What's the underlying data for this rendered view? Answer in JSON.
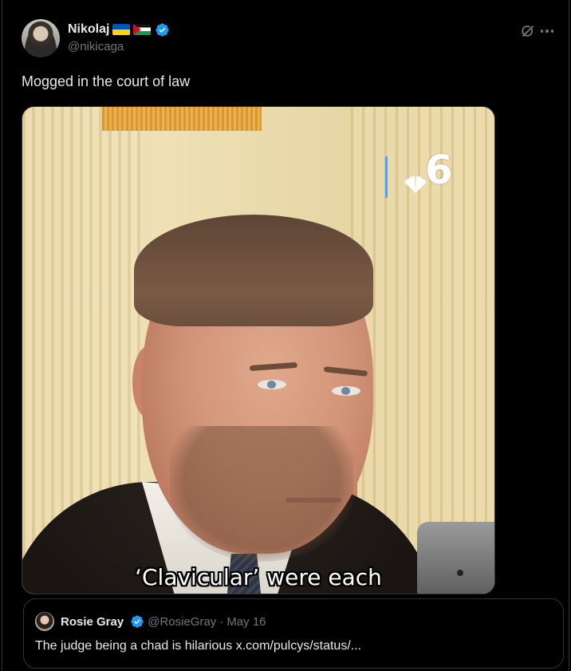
{
  "author": {
    "display_name": "Nikolaj",
    "handle": "@nikicaga",
    "flags": [
      "ukraine-flag-icon",
      "palestine-flag-icon"
    ],
    "verified": true
  },
  "actions": {
    "grok_icon": "grok-icon",
    "more_icon": "more-icon"
  },
  "post": {
    "text": "Mogged in the court of law"
  },
  "media": {
    "caption": "‘Clavicular’ were each",
    "station_number": "6"
  },
  "quote": {
    "display_name": "Rosie Gray",
    "handle": "@RosieGray",
    "separator": "·",
    "date": "May 16",
    "text": "The judge being a chad is hilarious x.com/pulcys/status/..."
  },
  "colors": {
    "background": "#000000",
    "text": "#e7e9ea",
    "muted": "#71767b",
    "border": "#2f3336",
    "verified": "#1d9bf0"
  }
}
